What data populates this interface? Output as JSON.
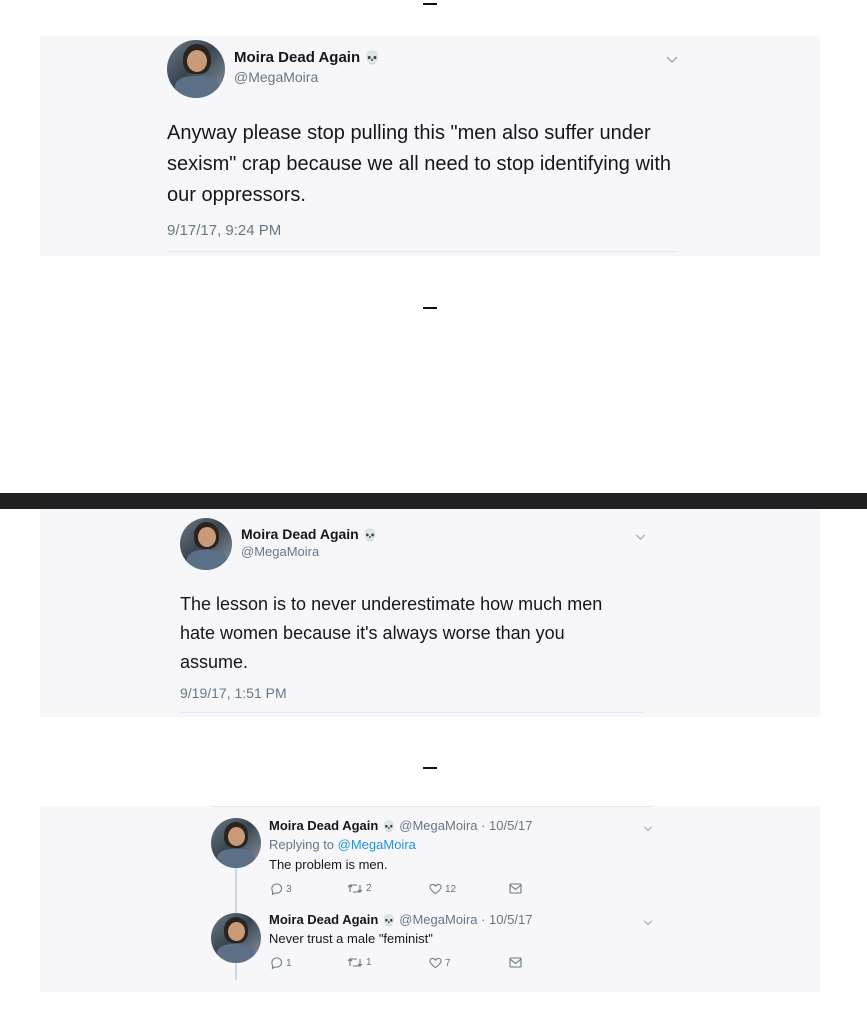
{
  "tweet1": {
    "name": "Moira Dead Again",
    "emoji": "💀",
    "handle": "@MegaMoira",
    "text": "Anyway please stop pulling this \"men also suffer under sexism\" crap because we all need to stop identifying with our oppressors.",
    "time": "9/17/17, 9:24 PM"
  },
  "tweet2": {
    "name": "Moira Dead Again",
    "emoji": "💀",
    "handle": "@MegaMoira",
    "text": "The lesson is to never underestimate how much men hate women because it's always worse than you assume.",
    "time": "9/19/17, 1:51 PM"
  },
  "thread": [
    {
      "name": "Moira Dead Again",
      "emoji": "💀",
      "meta": "@MegaMoira · 10/5/17",
      "replying_prefix": "Replying to ",
      "replying_handle": "@MegaMoira",
      "text": "The problem is men.",
      "replies": "3",
      "retweets": "2",
      "likes": "12"
    },
    {
      "name": "Moira Dead Again",
      "emoji": "💀",
      "meta": "@MegaMoira · 10/5/17",
      "text": "Never trust a male \"feminist\"",
      "replies": "1",
      "retweets": "1",
      "likes": "7"
    }
  ],
  "colors": {
    "accent": "#1b95e0",
    "divider_bar": "#1f2022"
  },
  "icons": [
    "chevron-down-icon",
    "reply-icon",
    "retweet-icon",
    "like-icon",
    "dm-icon",
    "skull-emoji"
  ]
}
